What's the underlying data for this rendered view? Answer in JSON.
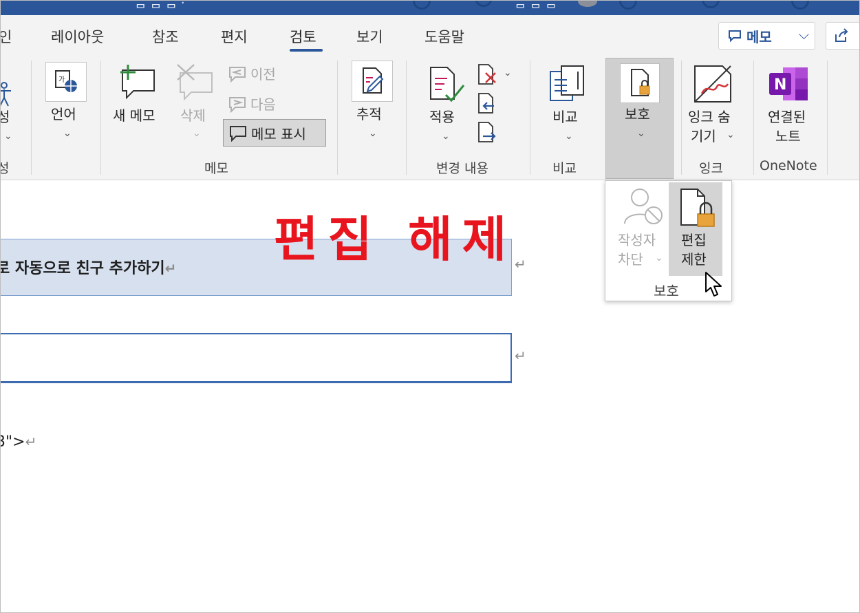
{
  "window": {
    "title_partial_left": "ᆷ ᆷ ᆷ ·",
    "title_partial_right": "ᆷ ᆷ ᆷ"
  },
  "tabs": [
    {
      "id": "tab-partial",
      "label": "인"
    },
    {
      "id": "tab-layout",
      "label": "레이아웃"
    },
    {
      "id": "tab-references",
      "label": "참조"
    },
    {
      "id": "tab-mailings",
      "label": "편지"
    },
    {
      "id": "tab-review",
      "label": "검토",
      "active": true
    },
    {
      "id": "tab-view",
      "label": "보기"
    },
    {
      "id": "tab-help",
      "label": "도움말"
    }
  ],
  "header_right": {
    "memo_label": "메모",
    "memo_chevron": "⌵"
  },
  "ribbon": {
    "accessibility": {
      "label_line1": "성",
      "chevron": "⌄",
      "group_label": "성"
    },
    "language": {
      "label": "언어",
      "chevron": "⌄"
    },
    "memo_group": {
      "new_memo": "새 메모",
      "delete": "삭제",
      "delete_chevron": "⌄",
      "previous": "이전",
      "next": "다음",
      "show_memo": "메모 표시",
      "group_label": "메모"
    },
    "tracking": {
      "label": "추적",
      "chevron": "⌄"
    },
    "changes": {
      "apply": "적용",
      "apply_chevron": "⌄",
      "reject_chevron": "⌄",
      "group_label": "변경 내용"
    },
    "compare": {
      "label": "비교",
      "chevron": "⌄",
      "group_label": "비교"
    },
    "protect": {
      "label": "보호",
      "chevron": "⌄"
    },
    "ink": {
      "label_line1": "잉크 숨",
      "label_line2": "기기",
      "chevron": "⌄",
      "group_label": "잉크"
    },
    "onenote": {
      "label_line1": "연결된",
      "label_line2": "노트",
      "group_label": "OneNote",
      "brand_color": "#7719aa"
    }
  },
  "protect_dropdown": {
    "block_authors_line1": "작성자",
    "block_authors_line2": "차단",
    "block_chevron": "⌄",
    "restrict_editing_line1": "편집",
    "restrict_editing_line2": "제한",
    "group_label": "보호"
  },
  "overlay": {
    "annotation": "편집 해제",
    "color": "#e8141e"
  },
  "document": {
    "heading_text": "로 자동으로 친구 추가하기",
    "line3_text": "3\">",
    "paragraph_mark": "↵"
  },
  "colors": {
    "accent": "#2b579a",
    "ribbon_bg": "#f3f3f3",
    "heading_bg": "#d6e0ef"
  }
}
